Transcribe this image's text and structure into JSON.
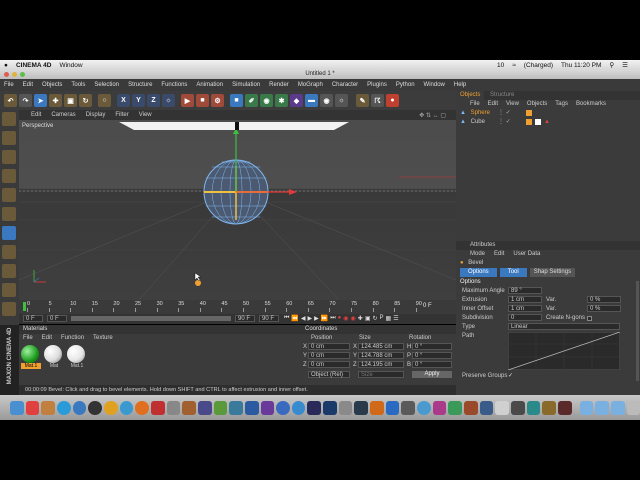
{
  "mac_menu": {
    "apple": "",
    "app": "CINEMA 4D",
    "window": "Window",
    "battery": "(Charged)",
    "clock": "Thu 11:20 PM",
    "volume": "10"
  },
  "window_title": "Untitled 1 *",
  "c4d_menu": [
    "File",
    "Edit",
    "Objects",
    "Tools",
    "Selection",
    "Structure",
    "Functions",
    "Animation",
    "Simulation",
    "Render",
    "MoGraph",
    "Character",
    "Plugins",
    "Python",
    "Window",
    "Help"
  ],
  "viewport": {
    "menu": [
      "Edit",
      "Cameras",
      "Display",
      "Filter",
      "View"
    ],
    "label": "Perspective"
  },
  "timeline": {
    "ticks": [
      "0",
      "5",
      "10",
      "15",
      "20",
      "25",
      "30",
      "35",
      "40",
      "45",
      "50",
      "55",
      "60",
      "65",
      "70",
      "75",
      "80",
      "85",
      "90"
    ],
    "end_frame": "0 F",
    "start": "0 F",
    "min": "0 F",
    "max": "90 F",
    "end": "90 F"
  },
  "materials": {
    "title": "Materials",
    "menu": [
      "File",
      "Edit",
      "Function",
      "Texture"
    ],
    "items": [
      "Mat.1",
      "Mat",
      "Mat.1"
    ]
  },
  "coordinates": {
    "title": "Coordinates",
    "cols": [
      "Position",
      "Size",
      "Rotation"
    ],
    "rows": [
      {
        "axis": "X",
        "pos": "0 cm",
        "size_axis": "X",
        "size": "124.485 cm",
        "rot_axis": "H",
        "rot": "0 °"
      },
      {
        "axis": "Y",
        "pos": "0 cm",
        "size_axis": "Y",
        "size": "124.788 cm",
        "rot_axis": "P",
        "rot": "0 °"
      },
      {
        "axis": "Z",
        "pos": "0 cm",
        "size_axis": "Z",
        "size": "124.195 cm",
        "rot_axis": "B",
        "rot": "0 °"
      }
    ],
    "mode": "Object (Rel)",
    "size_mode": "Size",
    "apply": "Apply"
  },
  "object_manager": {
    "tabs": [
      "Objects",
      "Structure"
    ],
    "menu": [
      "File",
      "Edit",
      "View",
      "Objects",
      "Tags",
      "Bookmarks"
    ],
    "objects": [
      "Sphere",
      "Cube"
    ]
  },
  "attributes": {
    "title": "Attributes",
    "menu": [
      "Mode",
      "Edit",
      "User Data"
    ],
    "tool": "Bevel",
    "tabs": [
      "Options",
      "Tool",
      "Shap Settings"
    ],
    "section": "Options",
    "fields": [
      {
        "label": "Maximum Angle",
        "value": "89 °"
      },
      {
        "label": "Extrusion",
        "value": "1 cm",
        "label2": "Var.",
        "value2": "0 %"
      },
      {
        "label": "Inner Offset",
        "value": "1 cm",
        "label2": "Var.",
        "value2": "0 %"
      },
      {
        "label": "Subdivision",
        "value": "0",
        "label2": "Create N-gons",
        "value2": ""
      }
    ],
    "type_label": "Type",
    "type_value": "Linear",
    "path_label": "Path",
    "preserve": "Preserve Groups"
  },
  "status": "00:00:09  Bevel: Click and drag to bevel elements. Hold down SHIFT and CTRL to affect extrusion and inner offset.",
  "maxon": "MAXON CINEMA 4D",
  "colors": {
    "accent": "#f0a030",
    "selected": "#3a78c0",
    "sphere": "#7fb6f0"
  }
}
